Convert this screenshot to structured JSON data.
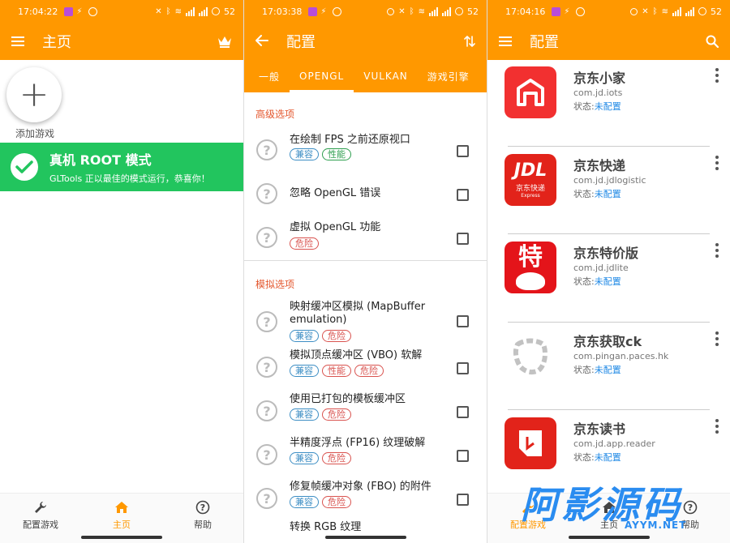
{
  "status_bars": [
    {
      "time": "17:04:22",
      "battery": "52"
    },
    {
      "time": "17:03:38",
      "battery": "52"
    },
    {
      "time": "17:04:16",
      "battery": "52"
    }
  ],
  "panel1": {
    "title": "主页",
    "fab_label": "添加游戏",
    "banner": {
      "title": "真机 ROOT 模式",
      "subtitle": "GLTools 正以最佳的模式运行，恭喜你！",
      "color": "#22c55e"
    },
    "nav": [
      {
        "label": "配置游戏",
        "icon": "wrench-icon"
      },
      {
        "label": "主页",
        "icon": "home-icon",
        "active": true
      },
      {
        "label": "帮助",
        "icon": "help-icon"
      }
    ]
  },
  "panel2": {
    "title": "配置",
    "tabs": [
      "一般",
      "OPENGL",
      "VULKAN",
      "游戏引擎"
    ],
    "active_tab": 1,
    "sections": [
      {
        "title": "高级选项",
        "options": [
          {
            "label": "在绘制 FPS 之前还原视口",
            "chips": [
              {
                "text": "兼容",
                "kind": "compat"
              },
              {
                "text": "性能",
                "kind": "perf"
              }
            ]
          },
          {
            "label": "忽略 OpenGL 错误",
            "chips": []
          },
          {
            "label": "虚拟 OpenGL 功能",
            "chips": [
              {
                "text": "危险",
                "kind": "danger"
              }
            ]
          }
        ]
      },
      {
        "title": "模拟选项",
        "options": [
          {
            "label": "映射缓冲区模拟 (MapBuffer emulation)",
            "chips": [
              {
                "text": "兼容",
                "kind": "compat"
              },
              {
                "text": "危险",
                "kind": "danger"
              }
            ]
          },
          {
            "label": "模拟顶点缓冲区 (VBO) 软解",
            "chips": [
              {
                "text": "兼容",
                "kind": "compat"
              },
              {
                "text": "性能",
                "kind": "danger"
              },
              {
                "text": "危险",
                "kind": "danger"
              }
            ]
          },
          {
            "label": "使用已打包的模板缓冲区",
            "chips": [
              {
                "text": "兼容",
                "kind": "compat"
              },
              {
                "text": "危险",
                "kind": "danger"
              }
            ]
          },
          {
            "label": "半精度浮点 (FP16) 纹理破解",
            "chips": [
              {
                "text": "兼容",
                "kind": "compat"
              },
              {
                "text": "危险",
                "kind": "danger"
              }
            ]
          },
          {
            "label": "修复帧缓冲对象 (FBO) 的附件",
            "chips": [
              {
                "text": "兼容",
                "kind": "compat"
              },
              {
                "text": "危险",
                "kind": "danger"
              }
            ]
          },
          {
            "label": "转换 RGB 纹理",
            "chips": []
          }
        ]
      }
    ]
  },
  "panel3": {
    "title": "配置",
    "status_label": "状态:",
    "apps": [
      {
        "name": "京东小家",
        "package": "com.jd.iots",
        "status": "未配置"
      },
      {
        "name": "京东快递",
        "package": "com.jd.jdlogistic",
        "status": "未配置",
        "icon_text": "JDL",
        "icon_sub": "京东快递",
        "icon_sub2": "Express"
      },
      {
        "name": "京东特价版",
        "package": "com.jd.jdlite",
        "status": "未配置",
        "icon_text": "特"
      },
      {
        "name": "京东获取ck",
        "package": "com.pingan.paces.hk",
        "status": "未配置"
      },
      {
        "name": "京东读书",
        "package": "com.jd.app.reader",
        "status": "未配置"
      }
    ],
    "nav": [
      {
        "label": "配置游戏"
      },
      {
        "label": "主页"
      },
      {
        "label": "帮助"
      }
    ]
  },
  "watermark": {
    "text": "阿影源码",
    "sub": "AYYM.NET"
  },
  "colors": {
    "accent": "#ff9800",
    "section": "#e4572e",
    "status_value": "#1e88e5"
  }
}
